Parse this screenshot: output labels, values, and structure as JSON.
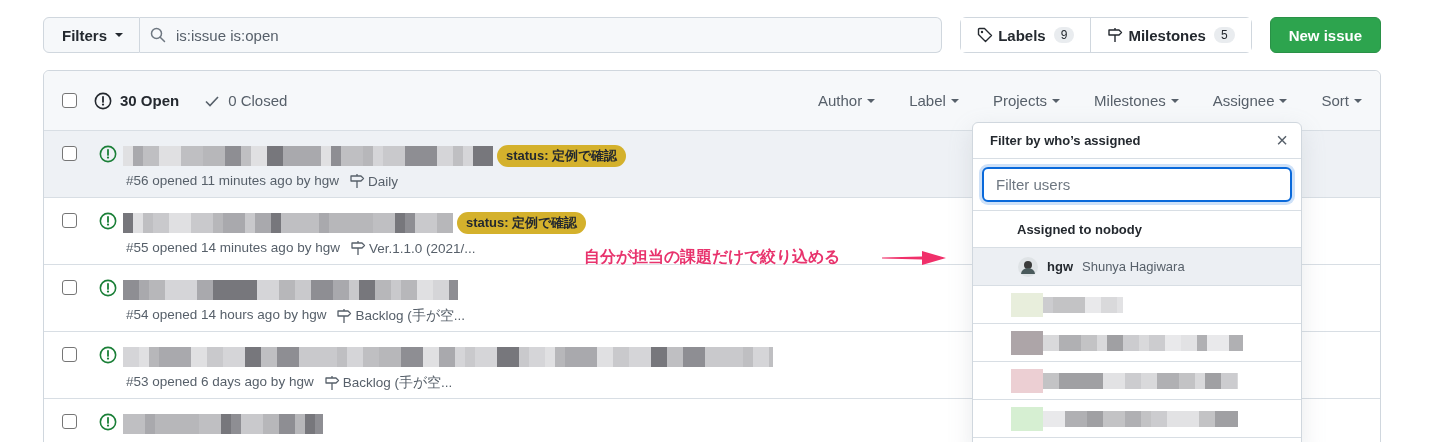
{
  "toolbar": {
    "filters_button": "Filters",
    "search": {
      "value": "is:issue is:open"
    },
    "labels": {
      "label": "Labels",
      "count": "9"
    },
    "milestones": {
      "label": "Milestones",
      "count": "5"
    },
    "new_issue_button": "New issue"
  },
  "issues_header": {
    "checked": false,
    "open": "30 Open",
    "closed": "0 Closed",
    "filters": [
      "Author",
      "Label",
      "Projects",
      "Milestones",
      "Assignee",
      "Sort"
    ]
  },
  "issues": [
    {
      "highlighted": true,
      "checked": false,
      "label": "status: 定例で確認",
      "meta": "#56 opened 11 minutes ago by hgw",
      "milestone": "Daily"
    },
    {
      "highlighted": false,
      "checked": false,
      "label": "status: 定例で確認",
      "meta": "#55 opened 14 minutes ago by hgw",
      "milestone": "Ver.1.1.0 (2021/..."
    },
    {
      "highlighted": false,
      "checked": false,
      "meta": "#54 opened 14 hours ago by hgw",
      "milestone": "Backlog (手が空..."
    },
    {
      "highlighted": false,
      "checked": false,
      "meta": "#53 opened 6 days ago by hgw",
      "milestone": "Backlog (手が空..."
    },
    {
      "highlighted": false,
      "checked": false
    }
  ],
  "assignee_menu": {
    "title": "Filter by who’s assigned",
    "close": "×",
    "filter": {
      "placeholder": "Filter users"
    },
    "nobody": "Assigned to nobody",
    "users": [
      {
        "kind": "user",
        "login": "hgw",
        "name": "Shunya Hagiwara",
        "highlighted": true
      },
      {
        "kind": "redacted"
      },
      {
        "kind": "redacted"
      },
      {
        "kind": "redacted"
      },
      {
        "kind": "redacted"
      }
    ]
  },
  "annotation": {
    "text": "自分が担当の課題だけで絞り込める"
  }
}
